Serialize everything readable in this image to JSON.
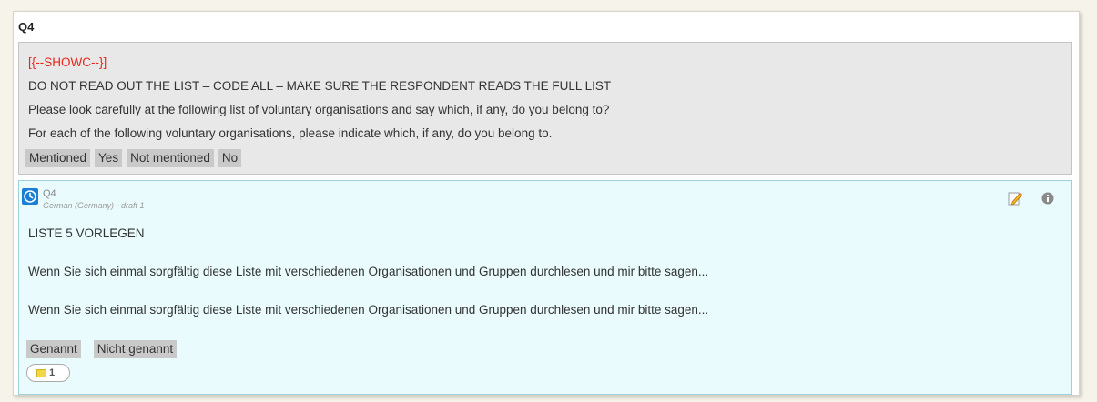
{
  "question": {
    "id": "Q4"
  },
  "source": {
    "show_code": "[{--SHOWC--}]",
    "lines": [
      "DO NOT READ OUT THE LIST – CODE ALL – MAKE SURE THE RESPONDENT READS THE FULL LIST",
      "Please look carefully at the following list of voluntary organisations and say which, if any, do you belong to?",
      "For each of the following voluntary organisations, please indicate which, if any, do you belong to."
    ],
    "options": [
      "Mentioned",
      "Yes",
      "Not mentioned",
      "No"
    ]
  },
  "translation": {
    "status_icon": "clock-icon",
    "question_id": "Q4",
    "language_label": "German (Germany) - draft 1",
    "lines": [
      "LISTE 5 VORLEGEN",
      "Wenn Sie sich einmal sorgfältig diese Liste mit verschiedenen Organisationen und Gruppen durchlesen und mir bitte sagen...",
      "Wenn Sie sich einmal sorgfältig diese Liste mit verschiedenen Organisationen und Gruppen durchlesen und mir bitte sagen..."
    ],
    "options": [
      "Genannt",
      "Nicht genannt"
    ],
    "comment_count": "1",
    "icons": {
      "edit": "pencil-icon",
      "info": "info-icon",
      "comment": "note-icon"
    }
  },
  "colors": {
    "show_code": "#e8261b",
    "status_icon": "#1a7fd4",
    "translation_bg": "#e9fbfd",
    "source_bg": "#e8e8e8"
  }
}
